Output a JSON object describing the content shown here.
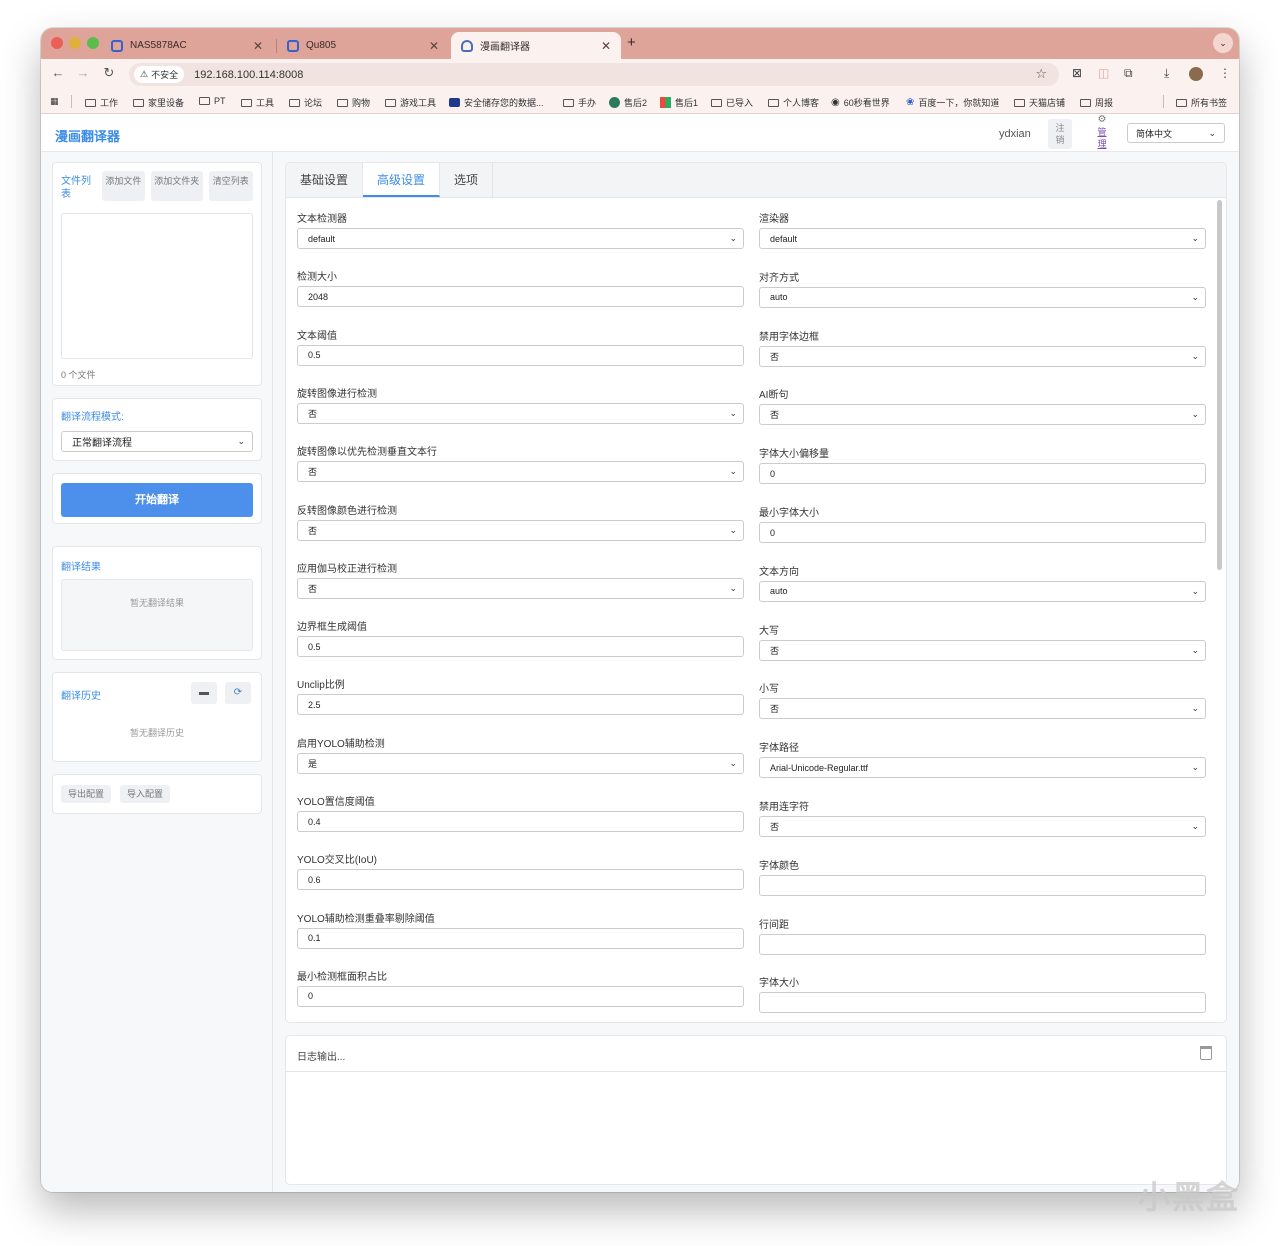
{
  "browser": {
    "tabs": [
      {
        "title": "NAS5878AC"
      },
      {
        "title": "Qu805"
      },
      {
        "title": "漫画翻译器"
      }
    ],
    "new_tab": "+",
    "url": "192.168.100.114:8008",
    "security_label": "不安全",
    "bookmarks": [
      "工作",
      "家里设备",
      "PT",
      "工具",
      "论坛",
      "购物",
      "游戏工具",
      "安全储存您的数据...",
      "手办",
      "售后2",
      "售后1",
      "已导入",
      "个人博客",
      "60秒看世界",
      "百度一下，你就知道",
      "天猫店铺",
      "周报",
      "所有书签"
    ]
  },
  "app": {
    "title": "漫画翻译器",
    "username": "ydxian",
    "logout": "注销",
    "admin": "管理",
    "language": "简体中文"
  },
  "sidebar": {
    "file_list_title": "文件列表",
    "add_file": "添加文件",
    "add_folder": "添加文件夹",
    "clear_list": "清空列表",
    "file_count": "0 个文件",
    "workflow_label": "翻译流程模式:",
    "workflow_value": "正常翻译流程",
    "start_button": "开始翻译",
    "results_title": "翻译结果",
    "results_empty": "暂无翻译结果",
    "history_title": "翻译历史",
    "history_empty": "暂无翻译历史",
    "export_config": "导出配置",
    "import_config": "导入配置"
  },
  "settings": {
    "tabs": [
      "基础设置",
      "高级设置",
      "选项"
    ],
    "active_tab": "高级设置",
    "left_fields": [
      {
        "label": "文本检测器",
        "value": "default",
        "type": "select"
      },
      {
        "label": "检测大小",
        "value": "2048",
        "type": "input"
      },
      {
        "label": "文本阈值",
        "value": "0.5",
        "type": "input"
      },
      {
        "label": "旋转图像进行检测",
        "value": "否",
        "type": "select"
      },
      {
        "label": "旋转图像以优先检测垂直文本行",
        "value": "否",
        "type": "select"
      },
      {
        "label": "反转图像颜色进行检测",
        "value": "否",
        "type": "select"
      },
      {
        "label": "应用伽马校正进行检测",
        "value": "否",
        "type": "select"
      },
      {
        "label": "边界框生成阈值",
        "value": "0.5",
        "type": "input"
      },
      {
        "label": "Unclip比例",
        "value": "2.5",
        "type": "input"
      },
      {
        "label": "启用YOLO辅助检测",
        "value": "是",
        "type": "select"
      },
      {
        "label": "YOLO置信度阈值",
        "value": "0.4",
        "type": "input"
      },
      {
        "label": "YOLO交叉比(IoU)",
        "value": "0.6",
        "type": "input"
      },
      {
        "label": "YOLO辅助检测重叠率剔除阈值",
        "value": "0.1",
        "type": "input"
      },
      {
        "label": "最小检测框面积占比",
        "value": "0",
        "type": "input"
      }
    ],
    "right_fields": [
      {
        "label": "渲染器",
        "value": "default",
        "type": "select"
      },
      {
        "label": "对齐方式",
        "value": "auto",
        "type": "select"
      },
      {
        "label": "禁用字体边框",
        "value": "否",
        "type": "select"
      },
      {
        "label": "AI断句",
        "value": "否",
        "type": "select"
      },
      {
        "label": "字体大小偏移量",
        "value": "0",
        "type": "input"
      },
      {
        "label": "最小字体大小",
        "value": "0",
        "type": "input"
      },
      {
        "label": "文本方向",
        "value": "auto",
        "type": "select"
      },
      {
        "label": "大写",
        "value": "否",
        "type": "select"
      },
      {
        "label": "小写",
        "value": "否",
        "type": "select"
      },
      {
        "label": "字体路径",
        "value": "Arial-Unicode-Regular.ttf",
        "type": "select"
      },
      {
        "label": "禁用连字符",
        "value": "否",
        "type": "select"
      },
      {
        "label": "字体颜色",
        "value": "",
        "type": "input"
      },
      {
        "label": "行间距",
        "value": "",
        "type": "input"
      },
      {
        "label": "字体大小",
        "value": "",
        "type": "input"
      }
    ]
  },
  "log": {
    "title": "日志输出..."
  },
  "watermark": "小黑盒",
  "colors": {
    "accent": "#3d8ce8",
    "primary_button": "#4c90eb",
    "tabstrip": "#dea49a"
  }
}
